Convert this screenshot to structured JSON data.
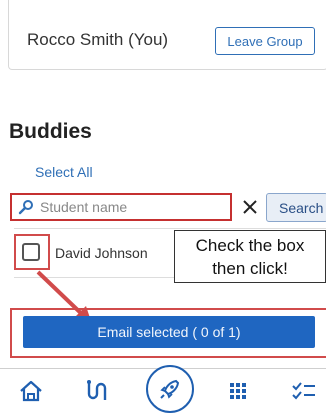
{
  "member": {
    "name": "Rocco Smith (You)",
    "leave_label": "Leave Group"
  },
  "buddies": {
    "title": "Buddies",
    "select_all": "Select All",
    "search_placeholder": "Student name",
    "search_label": "Search",
    "items": [
      {
        "name": "David Johnson",
        "checked": false
      }
    ],
    "email_label": "Email selected ( 0 of 1)"
  },
  "annotation": {
    "line1": "Check the box",
    "line2": "then click!"
  },
  "nav": {
    "items": [
      "home-icon",
      "route-icon",
      "rocket-icon",
      "grid-icon",
      "checklist-icon"
    ]
  },
  "colors": {
    "accent": "#1f66c1",
    "annotation_red": "#d14b4b"
  }
}
